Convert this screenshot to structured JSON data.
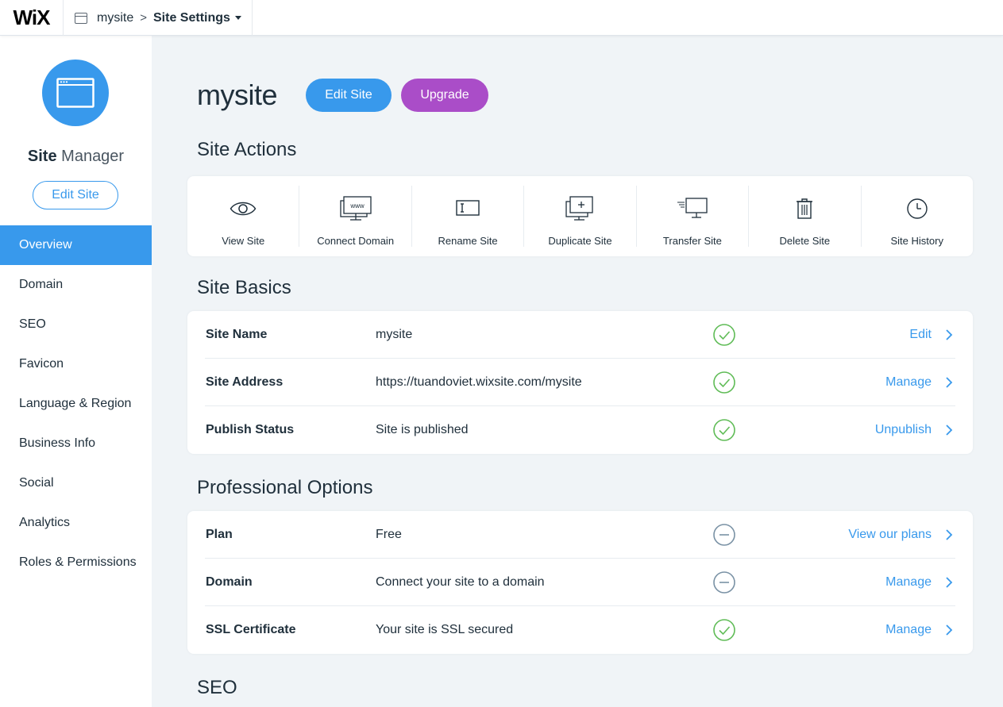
{
  "topbar": {
    "logo": "WiX",
    "site_name": "mysite",
    "separator": ">",
    "current_page": "Site Settings"
  },
  "sidebar": {
    "title_bold": "Site",
    "title_light": "Manager",
    "edit_button": "Edit Site",
    "items": [
      {
        "label": "Overview",
        "active": true
      },
      {
        "label": "Domain"
      },
      {
        "label": "SEO"
      },
      {
        "label": "Favicon"
      },
      {
        "label": "Language & Region"
      },
      {
        "label": "Business Info"
      },
      {
        "label": "Social"
      },
      {
        "label": "Analytics"
      },
      {
        "label": "Roles & Permissions"
      }
    ]
  },
  "main": {
    "site_title": "mysite",
    "edit_button": "Edit Site",
    "upgrade_button": "Upgrade",
    "site_actions": {
      "heading": "Site Actions",
      "items": [
        {
          "label": "View Site",
          "icon": "eye-icon"
        },
        {
          "label": "Connect Domain",
          "icon": "www-monitor-icon"
        },
        {
          "label": "Rename Site",
          "icon": "text-cursor-box-icon"
        },
        {
          "label": "Duplicate Site",
          "icon": "duplicate-monitor-icon"
        },
        {
          "label": "Transfer Site",
          "icon": "transfer-monitor-icon"
        },
        {
          "label": "Delete Site",
          "icon": "trash-icon"
        },
        {
          "label": "Site History",
          "icon": "clock-icon"
        }
      ]
    },
    "site_basics": {
      "heading": "Site Basics",
      "rows": [
        {
          "label": "Site Name",
          "value": "mysite",
          "status": "check",
          "action": "Edit"
        },
        {
          "label": "Site Address",
          "value": "https://tuandoviet.wixsite.com/mysite",
          "status": "check",
          "action": "Manage"
        },
        {
          "label": "Publish Status",
          "value": "Site is published",
          "status": "check",
          "action": "Unpublish"
        }
      ]
    },
    "professional_options": {
      "heading": "Professional Options",
      "rows": [
        {
          "label": "Plan",
          "value": "Free",
          "status": "minus",
          "action": "View our plans"
        },
        {
          "label": "Domain",
          "value": "Connect your site to a domain",
          "status": "minus",
          "action": "Manage"
        },
        {
          "label": "SSL Certificate",
          "value": "Your site is SSL secured",
          "status": "check",
          "action": "Manage"
        }
      ]
    },
    "seo": {
      "heading": "SEO"
    }
  },
  "colors": {
    "primary_blue": "#3899ec",
    "upgrade_purple": "#aa4dc8",
    "success_green": "#60bc57",
    "neutral_gray": "#7a92a5",
    "background": "#f0f4f7"
  }
}
